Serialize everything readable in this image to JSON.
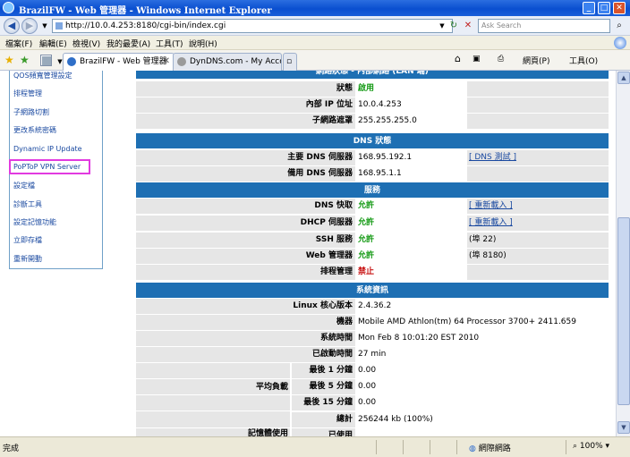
{
  "window": {
    "title": "BrazilFW - Web 管理器 - Windows Internet Explorer",
    "min": "_",
    "max": "□",
    "close": "✕"
  },
  "address": {
    "back": "◀",
    "forward": "▶",
    "url": "http://10.0.4.253:8180/cgi-bin/index.cgi",
    "refresh": "↻",
    "stop": "✕",
    "search_placeholder": "Ask Search",
    "search_go": "⌕"
  },
  "menu": [
    "檔案(F)",
    "編輯(E)",
    "檢視(V)",
    "我的最愛(A)",
    "工具(T)",
    "說明(H)"
  ],
  "tabs": [
    {
      "label": "BrazilFW - Web 管理器",
      "active": true
    },
    {
      "label": "DynDNS.com - My Account -...",
      "active": false
    }
  ],
  "toolbar": {
    "page": "網頁(P)",
    "tools": "工具(O)"
  },
  "sidebar": {
    "items": [
      "QOS頻寬管理設定",
      "排程管理",
      "子網路切割",
      "更改系統密碼",
      "Dynamic IP Update",
      "PoPToP VPN Server",
      "設定檔",
      "診斷工具",
      "設定記憶功能",
      "立即存檔",
      "重新開動"
    ]
  },
  "panel": {
    "lan_header": "網路狀態 - 內部網路 (LAN 端)",
    "lan": [
      {
        "label": "狀態",
        "value": "啟用",
        "style": "green"
      },
      {
        "label": "內部 IP 位址",
        "value": "10.0.4.253"
      },
      {
        "label": "子網路遮罩",
        "value": "255.255.255.0"
      }
    ],
    "dns_header": "DNS 狀態",
    "dns": [
      {
        "label": "主要 DNS 伺服器",
        "value": "168.95.192.1",
        "extra": "[ DNS 測試 ]"
      },
      {
        "label": "備用 DNS 伺服器",
        "value": "168.95.1.1"
      }
    ],
    "svc_header": "服務",
    "services": [
      {
        "label": "DNS 快取",
        "value": "允許",
        "style": "green",
        "extra": "[ 重新載入 ]"
      },
      {
        "label": "DHCP 伺服器",
        "value": "允許",
        "style": "green",
        "extra": "[ 重新載入 ]"
      },
      {
        "label": "SSH 服務",
        "value": "允許",
        "style": "green",
        "extra": "(埠 22)"
      },
      {
        "label": "Web 管理器",
        "value": "允許",
        "style": "green",
        "extra": "(埠 8180)"
      },
      {
        "label": "排程管理",
        "value": "禁止",
        "style": "red"
      }
    ],
    "sys_header": "系統資訊",
    "system": [
      {
        "label": "Linux 核心版本",
        "value": "2.4.36.2"
      },
      {
        "label": "機器",
        "value": "Mobile AMD Athlon(tm) 64 Processor 3700+ 2411.659"
      },
      {
        "label": "系統時間",
        "value": "Mon Feb 8 10:01:20 EST 2010"
      },
      {
        "label": "已啟動時間",
        "value": "27 min"
      }
    ],
    "load_group": "平均負載",
    "load": [
      {
        "label": "最後 1 分鐘",
        "value": "0.00"
      },
      {
        "label": "最後 5 分鐘",
        "value": "0.00"
      },
      {
        "label": "最後 15 分鐘",
        "value": "0.00"
      }
    ],
    "mem_total": {
      "label": "總計",
      "value": "256244 kb (100%)"
    },
    "mem_group": "記憶體使用",
    "mem_used_label": "已使用"
  },
  "status": {
    "text": "完成",
    "zone": "網際網路",
    "zoom": "100%"
  }
}
